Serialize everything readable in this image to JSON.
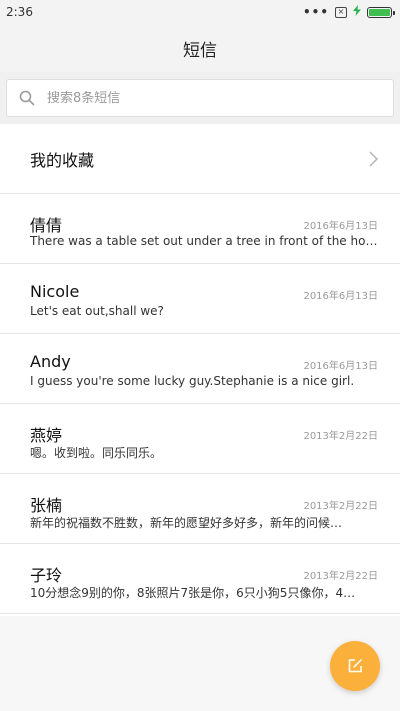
{
  "status_bar": {
    "time": "2:36",
    "dots": "•••",
    "sim_mark": "×",
    "battery_level": 1.0,
    "icons": [
      "more-dots-icon",
      "no-sim-icon",
      "charging-icon",
      "battery-icon"
    ]
  },
  "header": {
    "title": "短信"
  },
  "search": {
    "placeholder": "搜索8条短信"
  },
  "favorites": {
    "label": "我的收藏"
  },
  "messages": [
    {
      "name": "倩倩",
      "date": "2016年6月13日",
      "preview": "There was a table set out under a tree in front of the hous"
    },
    {
      "name": "Nicole",
      "date": "2016年6月13日",
      "preview": "Let's eat out,shall we?"
    },
    {
      "name": "Andy",
      "date": "2016年6月13日",
      "preview": "I guess you're some lucky guy.Stephanie is a nice girl."
    },
    {
      "name": "燕婷",
      "date": "2013年2月22日",
      "preview": "嗯。收到啦。同乐同乐。"
    },
    {
      "name": "张楠",
      "date": "2013年2月22日",
      "preview": "新年的祝福数不胜数，新年的愿望好多好多，新年的问候…"
    },
    {
      "name": "子玲",
      "date": "2013年2月22日",
      "preview": "10分想念9别的你，8张照片7张是你，6只小狗5只像你，4…"
    }
  ],
  "colors": {
    "accent": "#fbb03b",
    "battery": "#3fbf4f",
    "date_text": "#9a9a9a"
  }
}
